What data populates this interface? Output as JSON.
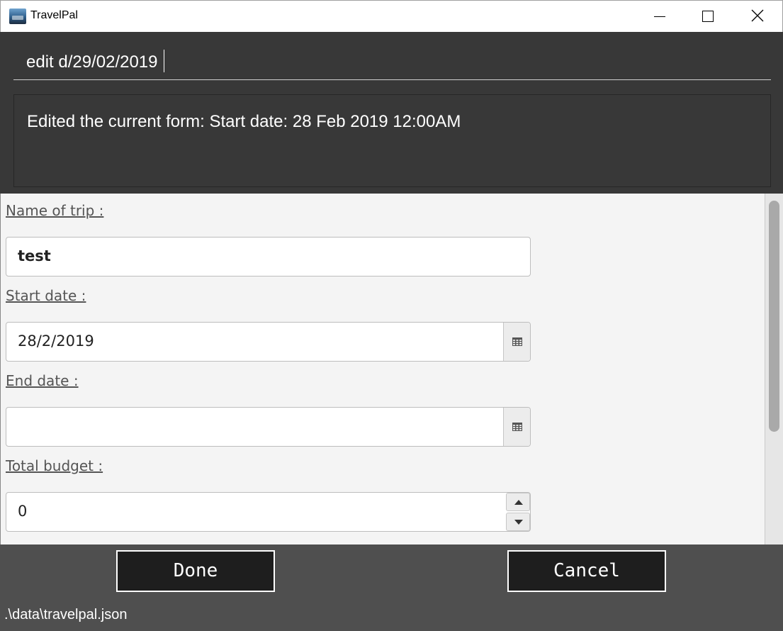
{
  "window": {
    "title": "TravelPal",
    "icon": "travelpal-app-icon"
  },
  "command": {
    "value": "edit d/29/02/2019"
  },
  "result": {
    "message": "Edited the current form: Start date: 28 Feb 2019 12:00AM"
  },
  "form": {
    "fields": [
      {
        "label": "Name of trip :",
        "value": "test"
      },
      {
        "label": "Start date :",
        "value": "28/2/2019"
      },
      {
        "label": "End date :",
        "value": ""
      },
      {
        "label": "Total budget :",
        "value": "0"
      }
    ]
  },
  "buttons": {
    "done": "Done",
    "cancel": "Cancel"
  },
  "status": {
    "file_path": ".\\data\\travelpal.json"
  },
  "colors": {
    "dark_bg": "#383838",
    "form_bg": "#f4f4f4",
    "button_bg": "#1e1e1e",
    "button_bar_bg": "#4f4f4f"
  }
}
